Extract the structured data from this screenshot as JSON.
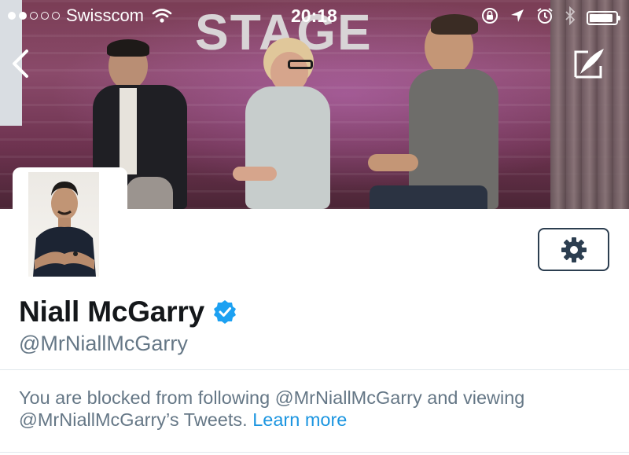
{
  "status_bar": {
    "signal_dots_filled": 2,
    "signal_dots_total": 5,
    "carrier": "Swisscom",
    "time": "20:18",
    "icons": [
      "wifi-icon",
      "orientation-lock-icon",
      "location-arrow-icon",
      "alarm-icon",
      "bluetooth-icon",
      "battery-icon"
    ],
    "battery_level": 0.9
  },
  "header": {
    "banner_sign_text": "STAGE",
    "back_icon": "chevron-left-icon",
    "compose_icon": "compose-feather-icon"
  },
  "profile": {
    "display_name": "Niall McGarry",
    "verified": true,
    "handle": "@MrNiallMcGarry",
    "settings_icon": "gear-icon"
  },
  "blocked_notice": {
    "text": "You are blocked from following @MrNiallMcGarry and viewing @MrNiallMcGarry’s Tweets.",
    "link_label": "Learn more"
  },
  "colors": {
    "link": "#1b95e0",
    "verified_badge": "#1da1f2",
    "secondary_text": "#657786",
    "primary_text": "#14171a",
    "divider": "#e1e8ed"
  }
}
